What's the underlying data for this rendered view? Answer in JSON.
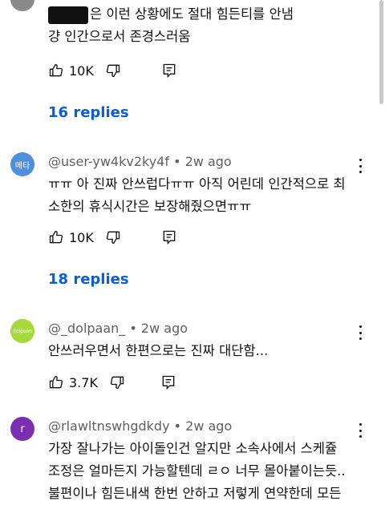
{
  "comments": [
    {
      "handle": "",
      "time": "",
      "lines": [
        "은 이런 상황에도 절대 힘든티를 안냄",
        "걍 인간으로서 존경스러움"
      ],
      "likes": "10K",
      "replies": "16 replies"
    },
    {
      "avatar_text": "메타",
      "avatar_color": "#4f8fdc",
      "handle": "@user-yw4kv2ky4f • 2w ago",
      "lines": [
        "ㅠㅠ 아 진짜 안쓰럽다ㅠㅠ 아직 어린데 인간적으로 최",
        "소한의 휴식시간은 보장해줬으면ㅠㅠ"
      ],
      "likes": "10K",
      "replies": "18 replies"
    },
    {
      "avatar_text": "dolpaan",
      "avatar_color": "#a7d93b",
      "handle": "@_dolpaan_ • 2w ago",
      "lines": [
        "안쓰러우면서 한편으로는 진짜 대단함..."
      ],
      "likes": "3.7K"
    },
    {
      "avatar_text": "r",
      "avatar_color": "#7b2fb0",
      "handle": "@rlawltnswhgdkdy • 2w ago",
      "lines": [
        "가장 잘나가는 아이돌인건 알지만 소속사에서 스케쥴",
        "조정은 얼마든지 가능할텐데 ㄹㅇ 너무 몰아붙이는듯..",
        "불편이나 힘든내색 한번 안하고 저렇게 연약한데 모든"
      ]
    }
  ]
}
